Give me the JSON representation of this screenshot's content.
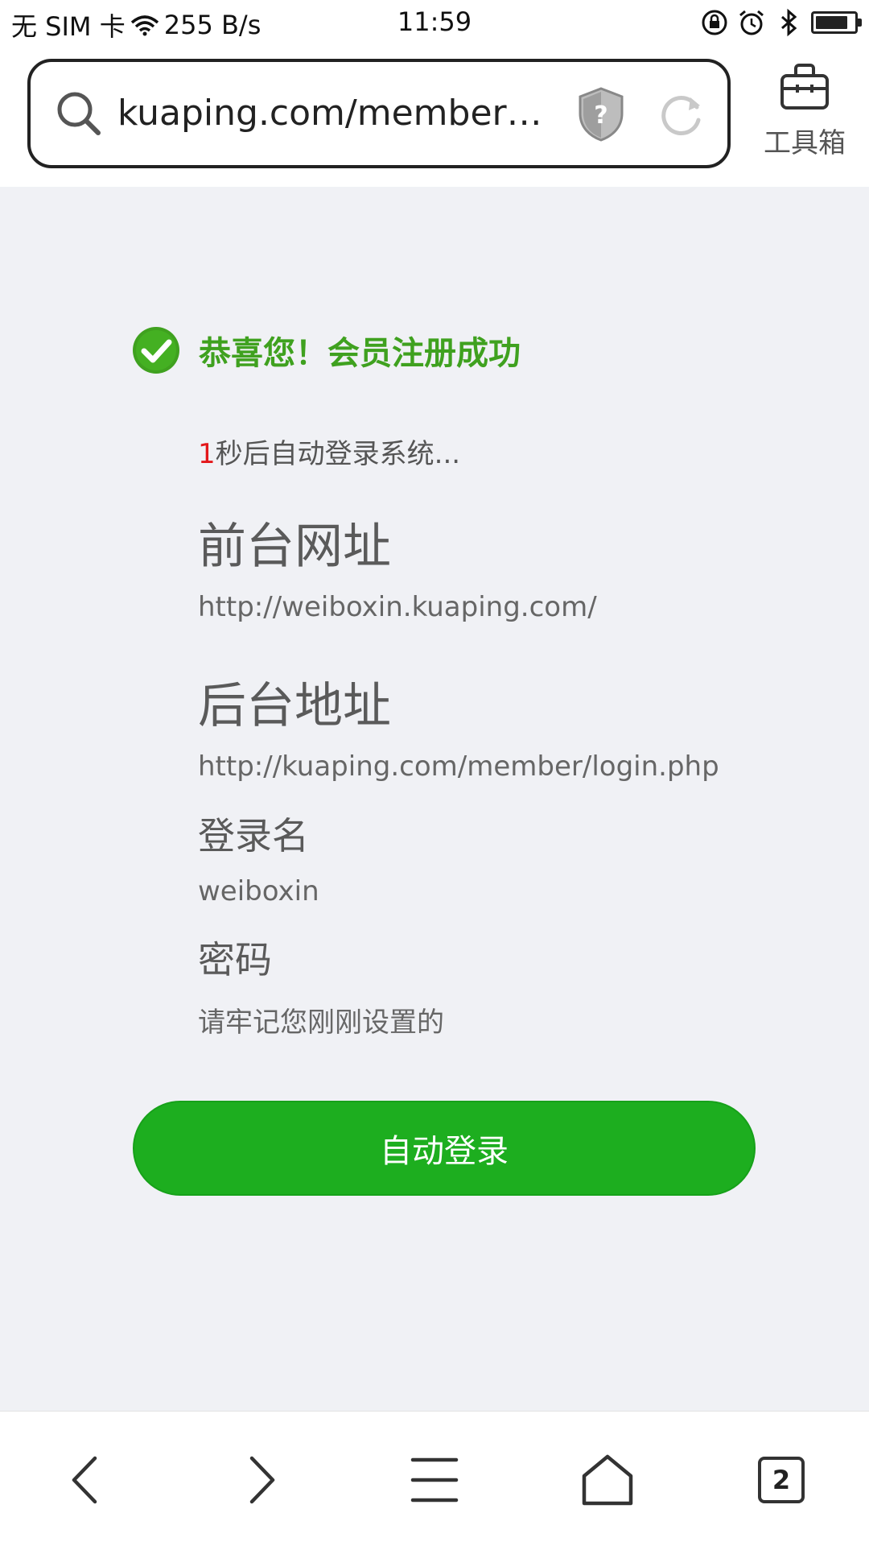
{
  "status_bar": {
    "carrier": "无 SIM 卡",
    "net_speed": "255 B/s",
    "time": "11:59",
    "battery_level": 0.85,
    "icons": [
      "wifi-icon",
      "orientation-lock-icon",
      "alarm-icon",
      "bluetooth-icon",
      "battery-icon"
    ]
  },
  "address_bar": {
    "url": "kuaping.com/member/sig...",
    "icons": [
      "search-icon",
      "shield-question-icon",
      "refresh-icon"
    ]
  },
  "toolbox": {
    "label": "工具箱",
    "icon": "toolbox-icon"
  },
  "page": {
    "success_title": "恭喜您！会员注册成功",
    "countdown_number": "1",
    "countdown_text": "秒后自动登录系统...",
    "frontend_label": "前台网址",
    "frontend_url": "http://weiboxin.kuaping.com/",
    "backend_label": "后台地址",
    "backend_url": "http://kuaping.com/member/login.php",
    "login_name_label": "登录名",
    "login_name": "weiboxin",
    "password_label": "密码",
    "password_hint": "请牢记您刚刚设置的",
    "auto_login_button": "自动登录"
  },
  "bottom_nav": {
    "tabs_count": "2",
    "icons": [
      "back-icon",
      "forward-icon",
      "menu-icon",
      "home-icon",
      "tabs-icon"
    ]
  },
  "colors": {
    "success_green": "#3fa11f",
    "button_green": "#1dae1f",
    "countdown_red": "#e3171a",
    "page_bg": "#f0f1f5"
  }
}
